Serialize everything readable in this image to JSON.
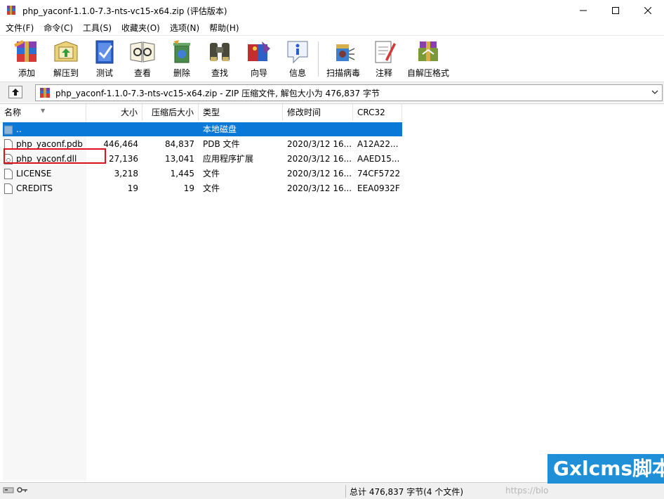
{
  "window": {
    "title": "php_yaconf-1.1.0-7.3-nts-vc15-x64.zip (评估版本)",
    "minimize_icon": "minimize-icon",
    "maximize_icon": "maximize-icon",
    "close_icon": "close-icon"
  },
  "menu": [
    "文件(F)",
    "命令(C)",
    "工具(S)",
    "收藏夹(O)",
    "选项(N)",
    "帮助(H)"
  ],
  "toolbar": {
    "add": "添加",
    "extract": "解压到",
    "test": "测试",
    "view": "查看",
    "delete": "删除",
    "find": "查找",
    "wizard": "向导",
    "info": "信息",
    "virus": "扫描病毒",
    "comment": "注释",
    "sfx": "自解压格式"
  },
  "address": {
    "path": "php_yaconf-1.1.0-7.3-nts-vc15-x64.zip - ZIP 压缩文件, 解包大小为 476,837 字节"
  },
  "columns": {
    "name": "名称",
    "size": "大小",
    "packed": "压缩后大小",
    "type": "类型",
    "modified": "修改时间",
    "crc": "CRC32"
  },
  "files": [
    {
      "name": "..",
      "size": "",
      "packed": "",
      "type": "本地磁盘",
      "modified": "",
      "crc": "",
      "icon": "folder-up-icon"
    },
    {
      "name": "php_yaconf.pdb",
      "size": "446,464",
      "packed": "84,837",
      "type": "PDB 文件",
      "modified": "2020/3/12 16...",
      "crc": "A12A22...",
      "icon": "file-icon"
    },
    {
      "name": "php_yaconf.dll",
      "size": "27,136",
      "packed": "13,041",
      "type": "应用程序扩展",
      "modified": "2020/3/12 16...",
      "crc": "AAED15...",
      "icon": "dll-file-icon"
    },
    {
      "name": "LICENSE",
      "size": "3,218",
      "packed": "1,445",
      "type": "文件",
      "modified": "2020/3/12 16...",
      "crc": "74CF5722",
      "icon": "file-icon"
    },
    {
      "name": "CREDITS",
      "size": "19",
      "packed": "19",
      "type": "文件",
      "modified": "2020/3/12 16...",
      "crc": "EEA0932F",
      "icon": "file-icon"
    }
  ],
  "status": {
    "summary": "总计 476,837 字节(4 个文件)",
    "url_watermark": "https://blo",
    "site_watermark": "Gxlcms脚本"
  },
  "colors": {
    "selection": "#0a78d7",
    "highlight_box": "#e0101c",
    "watermark_bg": "#1f8fd8"
  }
}
